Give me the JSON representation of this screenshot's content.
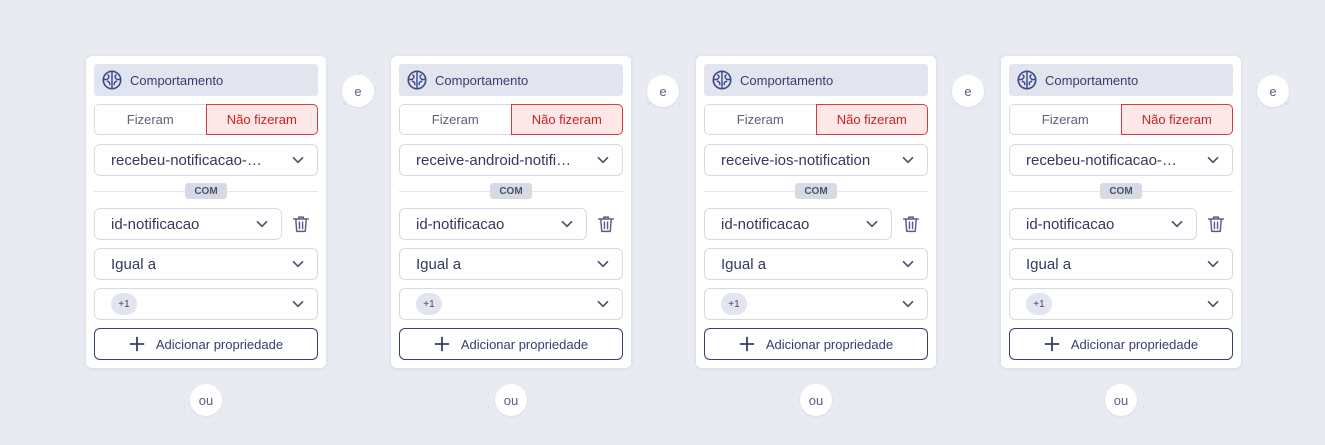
{
  "colors": {
    "accent": "#353d6e",
    "negative_active_text": "#c42424",
    "negative_active_bg": "#fde7e7",
    "header_bg": "#e2e5ef",
    "canvas_bg": "#e9ebf3"
  },
  "connectors": {
    "and_label": "e",
    "or_label": "ou"
  },
  "filters": [
    {
      "header": {
        "title": "Comportamento",
        "icon": "brain-icon"
      },
      "toggle": {
        "did": "Fizeram",
        "did_not": "Não fizeram",
        "selected": "did_not"
      },
      "event": "recebeu-notificacao-…",
      "with_label": "COM",
      "property": "id-notificacao",
      "operator": "Igual a",
      "values_count": "+1",
      "add_property_label": "Adicionar propriedade"
    },
    {
      "header": {
        "title": "Comportamento",
        "icon": "brain-icon"
      },
      "toggle": {
        "did": "Fizeram",
        "did_not": "Não fizeram",
        "selected": "did_not"
      },
      "event": "receive-android-notifi…",
      "with_label": "COM",
      "property": "id-notificacao",
      "operator": "Igual a",
      "values_count": "+1",
      "add_property_label": "Adicionar propriedade"
    },
    {
      "header": {
        "title": "Comportamento",
        "icon": "brain-icon"
      },
      "toggle": {
        "did": "Fizeram",
        "did_not": "Não fizeram",
        "selected": "did_not"
      },
      "event": "receive-ios-notification",
      "with_label": "COM",
      "property": "id-notificacao",
      "operator": "Igual a",
      "values_count": "+1",
      "add_property_label": "Adicionar propriedade"
    },
    {
      "header": {
        "title": "Comportamento",
        "icon": "brain-icon"
      },
      "toggle": {
        "did": "Fizeram",
        "did_not": "Não fizeram",
        "selected": "did_not"
      },
      "event": "recebeu-notificacao-…",
      "with_label": "COM",
      "property": "id-notificacao",
      "operator": "Igual a",
      "values_count": "+1",
      "add_property_label": "Adicionar propriedade"
    }
  ]
}
